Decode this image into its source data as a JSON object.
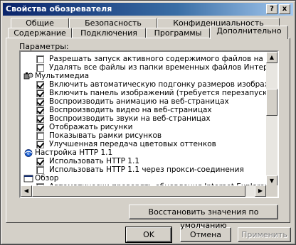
{
  "window": {
    "title": "Свойства обозревателя",
    "help_label": "?",
    "close_label": "x"
  },
  "tabs": {
    "row1": [
      {
        "label": "Общие"
      },
      {
        "label": "Безопасность"
      },
      {
        "label": "Конфиденциальность"
      }
    ],
    "row2": [
      {
        "label": "Содержание"
      },
      {
        "label": "Подключения"
      },
      {
        "label": "Программы"
      },
      {
        "label": "Дополнительно"
      }
    ]
  },
  "settings": {
    "label": "Параметры:",
    "rows": [
      {
        "type": "check",
        "checked": false,
        "label": "Разрешать запуск активного содержимого файлов на моем"
      },
      {
        "type": "check",
        "checked": false,
        "label": "Удалять все файлы из папки временных файлов Интернета"
      },
      {
        "type": "category",
        "icon": "multimedia-icon",
        "label": "Мультимедиа"
      },
      {
        "type": "check",
        "checked": true,
        "label": "Включить автоматическую подгонку размеров изображения"
      },
      {
        "type": "check",
        "checked": true,
        "label": "Включить панель изображений (требуется перезапуск)"
      },
      {
        "type": "check",
        "checked": true,
        "label": "Воспроизводить анимацию на веб-страницах"
      },
      {
        "type": "check",
        "checked": true,
        "label": "Воспроизводить видео на веб-страницах"
      },
      {
        "type": "check",
        "checked": true,
        "label": "Воспроизводить звуки на веб-страницах"
      },
      {
        "type": "check",
        "checked": true,
        "label": "Отображать рисунки"
      },
      {
        "type": "check",
        "checked": false,
        "label": "Показывать рамки рисунков"
      },
      {
        "type": "check",
        "checked": true,
        "label": "Улучшенная передача цветовых оттенков"
      },
      {
        "type": "category",
        "icon": "ie-globe-icon",
        "label": "Настройка HTTP 1.1"
      },
      {
        "type": "check",
        "checked": true,
        "label": "Использовать HTTP 1.1"
      },
      {
        "type": "check",
        "checked": false,
        "label": "Использовать HTTP 1.1 через прокси-соединения"
      },
      {
        "type": "category",
        "icon": "browse-icon",
        "label": "Обзор"
      },
      {
        "type": "check",
        "checked": false,
        "label": "Автоматически проверять обновления Internet Explorer."
      }
    ]
  },
  "buttons": {
    "restore_defaults": "Восстановить значения по умолчанию",
    "ok": "OK",
    "cancel": "Отмена",
    "apply": "Применить"
  }
}
